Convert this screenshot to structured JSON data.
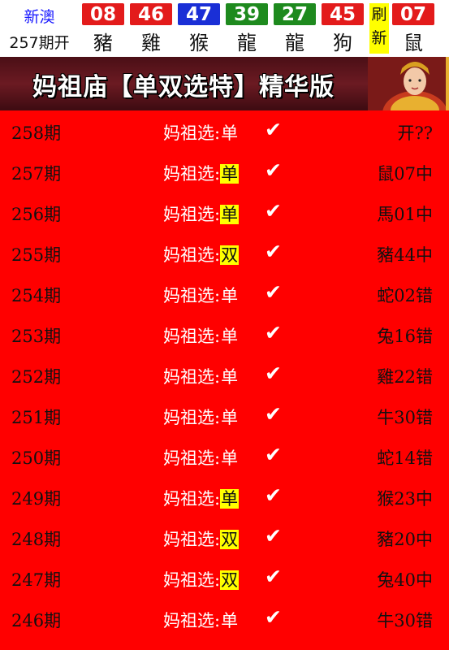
{
  "header": {
    "region": "新澳",
    "issue": "257期开",
    "balls": [
      {
        "num": "08",
        "zodiac": "豬",
        "color": "#e31b1b"
      },
      {
        "num": "46",
        "zodiac": "雞",
        "color": "#e31b1b"
      },
      {
        "num": "47",
        "zodiac": "猴",
        "color": "#1a2fd6"
      },
      {
        "num": "39",
        "zodiac": "龍",
        "color": "#1e8a1e"
      },
      {
        "num": "27",
        "zodiac": "龍",
        "color": "#1e8a1e"
      },
      {
        "num": "45",
        "zodiac": "狗",
        "color": "#e31b1b"
      }
    ],
    "refresh_label": "刷新",
    "special": {
      "num": "07",
      "zodiac": "鼠",
      "color": "#e31b1b"
    }
  },
  "banner": {
    "title": "妈祖庙【单双选特】精华版"
  },
  "colors": {
    "background": "#ff0000",
    "highlight": "#ffff00"
  },
  "rows": [
    {
      "period": "258期",
      "label": "妈祖选:",
      "value": "单",
      "highlight": false,
      "check": "✔",
      "result": "开??"
    },
    {
      "period": "257期",
      "label": "妈祖选:",
      "value": "单",
      "highlight": true,
      "check": "✔",
      "result": "鼠07中"
    },
    {
      "period": "256期",
      "label": "妈祖选:",
      "value": "单",
      "highlight": true,
      "check": "✔",
      "result": "馬01中"
    },
    {
      "period": "255期",
      "label": "妈祖选:",
      "value": "双",
      "highlight": true,
      "check": "✔",
      "result": "豬44中"
    },
    {
      "period": "254期",
      "label": "妈祖选:",
      "value": "单",
      "highlight": false,
      "check": "✔",
      "result": "蛇02错"
    },
    {
      "period": "253期",
      "label": "妈祖选:",
      "value": "单",
      "highlight": false,
      "check": "✔",
      "result": "兔16错"
    },
    {
      "period": "252期",
      "label": "妈祖选:",
      "value": "单",
      "highlight": false,
      "check": "✔",
      "result": "雞22错"
    },
    {
      "period": "251期",
      "label": "妈祖选:",
      "value": "单",
      "highlight": false,
      "check": "✔",
      "result": "牛30错"
    },
    {
      "period": "250期",
      "label": "妈祖选:",
      "value": "单",
      "highlight": false,
      "check": "✔",
      "result": "蛇14错"
    },
    {
      "period": "249期",
      "label": "妈祖选:",
      "value": "单",
      "highlight": true,
      "check": "✔",
      "result": "猴23中"
    },
    {
      "period": "248期",
      "label": "妈祖选:",
      "value": "双",
      "highlight": true,
      "check": "✔",
      "result": "豬20中"
    },
    {
      "period": "247期",
      "label": "妈祖选:",
      "value": "双",
      "highlight": true,
      "check": "✔",
      "result": "兔40中"
    },
    {
      "period": "246期",
      "label": "妈祖选:",
      "value": "单",
      "highlight": false,
      "check": "✔",
      "result": "牛30错"
    }
  ]
}
